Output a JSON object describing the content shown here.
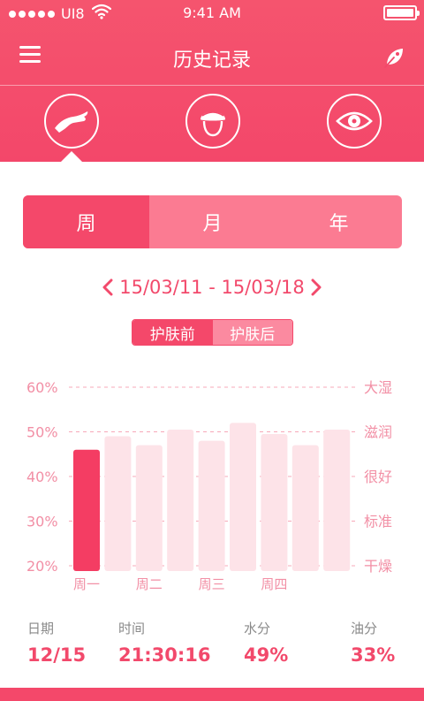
{
  "status_bar": {
    "carrier": "UI8",
    "time": "9:41 AM"
  },
  "header": {
    "title": "历史记录"
  },
  "categories": [
    {
      "icon": "hand-icon",
      "selected": true
    },
    {
      "icon": "face-towel-icon",
      "selected": false
    },
    {
      "icon": "eye-icon",
      "selected": false
    }
  ],
  "period_tabs": [
    {
      "label": "周",
      "active": true
    },
    {
      "label": "月",
      "active": false
    },
    {
      "label": "年",
      "active": false
    }
  ],
  "date_range": "15/03/11 - 15/03/18",
  "skincare_toggle": {
    "before": "护肤前",
    "after": "护肤后",
    "selected": "before"
  },
  "chart_data": {
    "type": "bar",
    "title": "",
    "xlabel": "",
    "ylabel": "",
    "ylim": [
      20,
      60
    ],
    "y_ticks": [
      "20%",
      "30%",
      "40%",
      "50%",
      "60%"
    ],
    "y_tick_values": [
      20,
      30,
      40,
      50,
      60
    ],
    "right_ticks": [
      "干燥",
      "标准",
      "很好",
      "滋润",
      "大湿"
    ],
    "x_tick_labels": [
      "周一",
      "周二",
      "周三",
      "周四"
    ],
    "x_tick_bar_index": [
      0,
      2,
      4,
      6
    ],
    "values": [
      46,
      49,
      47,
      50.5,
      48,
      52,
      49.5,
      47,
      50.5
    ],
    "highlight_index": 0,
    "grid": "dashed-horizontal",
    "colors": {
      "highlight": "#f43d63",
      "bar": "#fde3e8",
      "grid": "#f7a8b8",
      "tick": "#f28fa5"
    }
  },
  "metrics": [
    {
      "label": "日期",
      "value": "12/15"
    },
    {
      "label": "时间",
      "value": "21:30:16"
    },
    {
      "label": "水分",
      "value": "49%"
    },
    {
      "label": "油分",
      "value": "33%"
    }
  ],
  "colors": {
    "accent": "#f4486a",
    "accent_light": "#fb7b92",
    "text_muted": "#8a8a8a"
  }
}
